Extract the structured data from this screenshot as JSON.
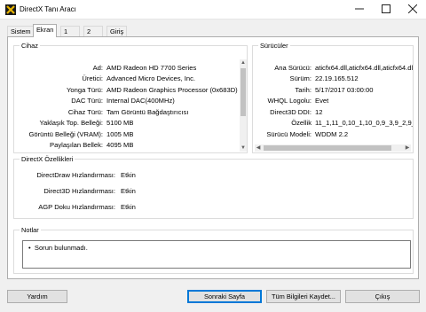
{
  "window": {
    "title": "DirectX Tanı Aracı",
    "icon": "directx-icon",
    "minimize_icon": "minimize-icon",
    "maximize_icon": "maximize-icon",
    "close_icon": "close-icon"
  },
  "tabs": [
    {
      "label": "Sistem",
      "active": false
    },
    {
      "label": "Ekran",
      "active": true
    },
    {
      "label": "1 Sesi",
      "active": false
    },
    {
      "label": "2 Sesi",
      "active": false
    },
    {
      "label": "Giriş",
      "active": false
    }
  ],
  "device": {
    "title": "Cihaz",
    "rows": [
      {
        "label": "Ad:",
        "value": "AMD Radeon HD 7700 Series"
      },
      {
        "label": "Üretici:",
        "value": "Advanced Micro Devices, Inc."
      },
      {
        "label": "Yonga Türü:",
        "value": "AMD Radeon Graphics Processor (0x683D)"
      },
      {
        "label": "DAC Türü:",
        "value": "Internal DAC(400MHz)"
      },
      {
        "label": "Cihaz Türü:",
        "value": "Tam Görüntü Bağdaştırıcısı"
      },
      {
        "label": "Yaklaşık Top. Belleği:",
        "value": "5100 MB"
      },
      {
        "label": "Görüntü Belleği (VRAM):",
        "value": "1005 MB"
      },
      {
        "label": "Paylaşılan Bellek:",
        "value": "4095 MB"
      }
    ]
  },
  "drivers": {
    "title": "Sürücüler",
    "rows": [
      {
        "label": "Ana Sürücü:",
        "value": "aticfx64.dll,aticfx64.dll,aticfx64.dll,am"
      },
      {
        "label": "Sürüm:",
        "value": "22.19.165.512"
      },
      {
        "label": "Tarih:",
        "value": "5/17/2017 03:00:00"
      },
      {
        "label": "WHQL Logolu:",
        "value": "Evet"
      },
      {
        "label": "Direct3D DDI:",
        "value": "12"
      },
      {
        "label": "Özellik",
        "value": "11_1,11_0,10_1,10_0,9_3,9_2,9_1"
      },
      {
        "label": "Sürücü Modeli:",
        "value": "WDDM 2.2"
      }
    ]
  },
  "features": {
    "title": "DirectX Özellikleri",
    "rows": [
      {
        "label": "DirectDraw Hızlandırması:",
        "value": "Etkin"
      },
      {
        "label": "Direct3D Hızlandırması:",
        "value": "Etkin"
      },
      {
        "label": "AGP Doku Hızlandırması:",
        "value": "Etkin"
      }
    ]
  },
  "notes": {
    "title": "Notlar",
    "items": [
      "Sorun bulunmadı."
    ]
  },
  "buttons": {
    "help": "Yardım",
    "next_page": "Sonraki Sayfa",
    "save_all": "Tüm Bilgileri Kaydet...",
    "exit": "Çıkış"
  },
  "colors": {
    "accent": "#0078d7",
    "window_bg": "#f0f0f0",
    "panel_bg": "#ffffff",
    "scroll_thumb": "#c2c2c2"
  }
}
